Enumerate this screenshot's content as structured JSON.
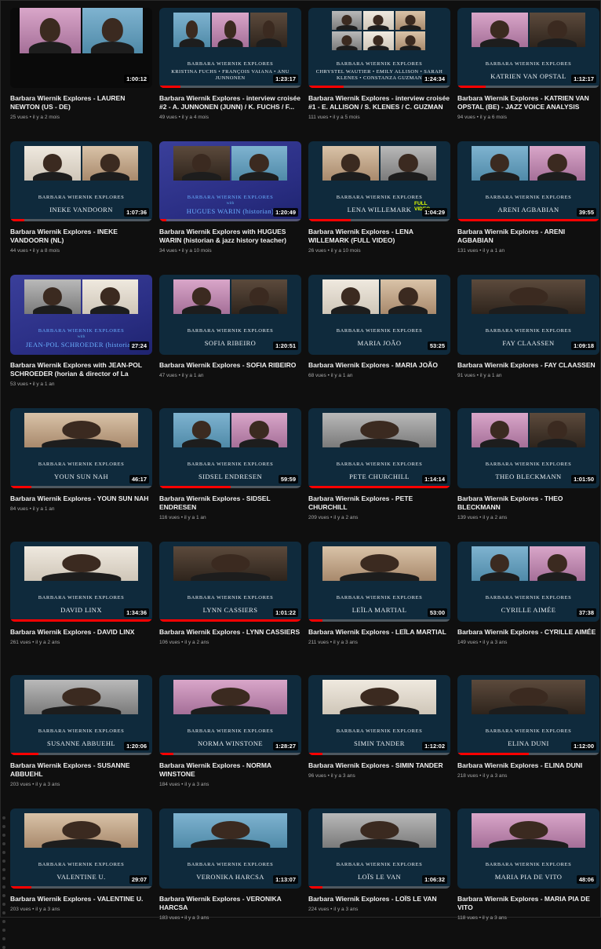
{
  "colors": {
    "background": "#0f0f0f",
    "thumbnail_navy": "#0f2a3c",
    "thumbnail_purple": "#2b2f85",
    "progress_red": "#ff0000",
    "meta_grey": "#aaaaaa"
  },
  "videos": [
    {
      "title": "Barbara Wiernik Explores - LAUREN NEWTON (US - DE)",
      "meta": "25 vues • il y a 2 mois",
      "duration": "1:00:12",
      "thumb_series": "",
      "thumb_name": "",
      "progress": 0.0,
      "style": "black",
      "photos": 2
    },
    {
      "title": "Barbara Wiernik Explores - interview croisée #2 - A. JUNNONEN (JUNN) / K. FUCHS / F...",
      "meta": "49 vues • il y a 4 mois",
      "duration": "1:23:17",
      "thumb_series": "BARBARA WIERNIK EXPLORES",
      "thumb_name": "KRISTINA FUCHS • FRANÇOIS VAIANA • ANU JUNNONEN",
      "progress": 0.15,
      "style": "navy",
      "photos": 3
    },
    {
      "title": "Barbara Wiernik Explores - interview croisée #1 - E. ALLISON / S. KLENES / C. GUZMAN ...",
      "meta": "111 vues • il y a 5 mois",
      "duration": "1:24:34",
      "thumb_series": "BARBARA WIERNIK EXPLORES",
      "thumb_name": "CHRYSTEL WAUTIER • EMILY ALLISON • SARAH KLENES • CONSTANZA GUZMAN",
      "progress": 0.25,
      "style": "navy",
      "photos": 6
    },
    {
      "title": "Barbara Wiernik Explores - KATRIEN VAN OPSTAL (BE) - JAZZ VOICE ANALYSIS",
      "meta": "94 vues • il y a 6 mois",
      "duration": "1:12:17",
      "thumb_series": "BARBARA WIERNIK EXPLORES",
      "thumb_name": "KATRIEN VAN OPSTAL",
      "progress": 0.2,
      "style": "navy",
      "photos": 2
    },
    {
      "title": "Barbara Wiernik Explores - INEKE VANDOORN (NL)",
      "meta": "44 vues • il y a 8 mois",
      "duration": "1:07:36",
      "thumb_series": "BARBARA WIERNIK EXPLORES",
      "thumb_name": "INEKE VANDOORN",
      "progress": 0.1,
      "style": "navy",
      "photos": 2
    },
    {
      "title": "Barbara Wiernik Explores with HUGUES WARIN (historian & jazz history teacher)",
      "meta": "34 vues • il y a 10 mois",
      "duration": "1:20:49",
      "thumb_series": "BARBARA WIERNIK EXPLORES",
      "thumb_name": "HUGUES WARIN (historian)",
      "thumb_with": "with",
      "progress": 0.05,
      "style": "purple",
      "photos": 2
    },
    {
      "title": "Barbara Wiernik Explores - LENA WILLEMARK (FULL VIDEO)",
      "meta": "26 vues • il y a 10 mois",
      "duration": "1:04:29",
      "thumb_series": "BARBARA WIERNIK EXPLORES",
      "thumb_name": "LENA WILLEMARK",
      "thumb_badge": "FULL VIDEO",
      "progress": 0.3,
      "style": "navy",
      "photos": 2
    },
    {
      "title": "Barbara Wiernik Explores - ARENI AGBABIAN",
      "meta": "131 vues • il y a 1 an",
      "duration": "39:55",
      "thumb_series": "BARBARA WIERNIK EXPLORES",
      "thumb_name": "ARENI AGBABIAN",
      "progress": 1.0,
      "style": "navy",
      "photos": 2
    },
    {
      "title": "Barbara Wiernik Explores with JEAN-POL SCHROEDER (horian & director of La Maiso...",
      "meta": "53 vues • il y a 1 an",
      "duration": "27:24",
      "thumb_series": "BARBARA WIERNIK EXPLORES",
      "thumb_name": "JEAN-POL SCHROEDER (historian)",
      "thumb_with": "with",
      "progress": 0.0,
      "style": "purple",
      "photos": 2
    },
    {
      "title": "Barbara Wiernik Explores - SOFIA RIBEIRO",
      "meta": "47 vues • il y a 1 an",
      "duration": "1:20:51",
      "thumb_series": "BARBARA WIERNIK EXPLORES",
      "thumb_name": "SOFIA RIBEIRO",
      "progress": 0.0,
      "style": "navy",
      "photos": 2
    },
    {
      "title": "Barbara Wiernik Explores - MARIA JOÃO",
      "meta": "68 vues • il y a 1 an",
      "duration": "53:25",
      "thumb_series": "BARBARA WIERNIK EXPLORES",
      "thumb_name": "MARIA JOÃO",
      "progress": 0.0,
      "style": "navy",
      "photos": 2
    },
    {
      "title": "Barbara Wiernik Explores - FAY CLAASSEN",
      "meta": "91 vues • il y a 1 an",
      "duration": "1:09:18",
      "thumb_series": "BARBARA WIERNIK EXPLORES",
      "thumb_name": "FAY CLAASSEN",
      "progress": 0.0,
      "style": "navy",
      "photos": 1
    },
    {
      "title": "Barbara Wiernik Explores - YOUN SUN NAH",
      "meta": "84 vues • il y a 1 an",
      "duration": "46:17",
      "thumb_series": "BARBARA WIERNIK EXPLORES",
      "thumb_name": "YOUN SUN NAH",
      "progress": 0.15,
      "style": "navy",
      "photos": 1
    },
    {
      "title": "Barbara Wiernik Explores - SIDSEL ENDRESEN",
      "meta": "116 vues • il y a 1 an",
      "duration": "59:59",
      "thumb_series": "BARBARA WIERNIK EXPLORES",
      "thumb_name": "SIDSEL ENDRESEN",
      "progress": 0.5,
      "style": "navy",
      "photos": 2
    },
    {
      "title": "Barbara Wiernik Explores - PETE CHURCHILL",
      "meta": "209 vues • il y a 2 ans",
      "duration": "1:14:14",
      "thumb_series": "BARBARA WIERNIK EXPLORES",
      "thumb_name": "PETE CHURCHILL",
      "progress": 1.0,
      "style": "navy",
      "photos": 1
    },
    {
      "title": "Barbara Wiernik Explores - THEO BLECKMANN",
      "meta": "139 vues • il y a 2 ans",
      "duration": "1:01:50",
      "thumb_series": "BARBARA WIERNIK EXPLORES",
      "thumb_name": "THEO BLECKMANN",
      "progress": 0.0,
      "style": "navy",
      "photos": 2
    },
    {
      "title": "Barbara Wiernik Explores - DAVID LINX",
      "meta": "261 vues • il y a 2 ans",
      "duration": "1:34:36",
      "thumb_series": "BARBARA WIERNIK EXPLORES",
      "thumb_name": "DAVID LINX",
      "progress": 1.0,
      "style": "navy",
      "photos": 1
    },
    {
      "title": "Barbara Wiernik Explores - LYNN CASSIERS",
      "meta": "106 vues • il y a 2 ans",
      "duration": "1:01:22",
      "thumb_series": "BARBARA WIERNIK EXPLORES",
      "thumb_name": "LYNN CASSIERS",
      "progress": 1.0,
      "style": "navy",
      "photos": 1
    },
    {
      "title": "Barbara Wiernik Explores - LEÏLA MARTIAL",
      "meta": "211 vues • il y a 3 ans",
      "duration": "53:00",
      "thumb_series": "BARBARA WIERNIK EXPLORES",
      "thumb_name": "LEÏLA MARTIAL",
      "progress": 0.1,
      "style": "navy",
      "photos": 1
    },
    {
      "title": "Barbara Wiernik Explores - CYRILLE AIMÉE",
      "meta": "149 vues • il y a 3 ans",
      "duration": "37:38",
      "thumb_series": "BARBARA WIERNIK EXPLORES",
      "thumb_name": "CYRILLE AIMÉE",
      "progress": 0.0,
      "style": "navy",
      "photos": 2
    },
    {
      "title": "Barbara Wiernik Explores - SUSANNE ABBUEHL",
      "meta": "203 vues • il y a 3 ans",
      "duration": "1:20:06",
      "thumb_series": "BARBARA WIERNIK EXPLORES",
      "thumb_name": "SUSANNE ABBUEHL",
      "progress": 0.2,
      "style": "navy",
      "photos": 1
    },
    {
      "title": "Barbara Wiernik Explores - NORMA WINSTONE",
      "meta": "184 vues • il y a 3 ans",
      "duration": "1:28:27",
      "thumb_series": "BARBARA WIERNIK EXPLORES",
      "thumb_name": "NORMA WINSTONE",
      "progress": 0.1,
      "style": "navy",
      "photos": 1
    },
    {
      "title": "Barbara Wiernik Explores - SIMIN TANDER",
      "meta": "96 vues • il y a 3 ans",
      "duration": "1:12:02",
      "thumb_series": "BARBARA WIERNIK EXPLORES",
      "thumb_name": "SIMIN TANDER",
      "progress": 0.1,
      "style": "navy",
      "photos": 1
    },
    {
      "title": "Barbara Wiernik Explores - ELINA DUNI",
      "meta": "218 vues • il y a 3 ans",
      "duration": "1:12:00",
      "thumb_series": "BARBARA WIERNIK EXPLORES",
      "thumb_name": "ELINA DUNI",
      "progress": 0.5,
      "style": "navy",
      "photos": 1
    },
    {
      "title": "Barbara Wiernik Explores - VALENTINE U.",
      "meta": "203 vues • il y a 3 ans",
      "duration": "29:07",
      "thumb_series": "BARBARA WIERNIK EXPLORES",
      "thumb_name": "VALENTINE U.",
      "progress": 0.15,
      "style": "navy",
      "photos": 1
    },
    {
      "title": "Barbara Wiernik Explores - VERONIKA HARCSA",
      "meta": "183 vues • il y a 3 ans",
      "duration": "1:13:07",
      "thumb_series": "BARBARA WIERNIK EXPLORES",
      "thumb_name": "VERONIKA HARCSA",
      "progress": 0.0,
      "style": "navy",
      "photos": 1
    },
    {
      "title": "Barbara Wiernik Explores - LOÏS LE VAN",
      "meta": "224 vues • il y a 3 ans",
      "duration": "1:06:32",
      "thumb_series": "BARBARA WIERNIK EXPLORES",
      "thumb_name": "LOÏS LE VAN",
      "progress": 0.1,
      "style": "navy",
      "photos": 1
    },
    {
      "title": "Barbara Wiernik Explores - MARIA PIA DE VITO",
      "meta": "118 vues • il y a 3 ans",
      "duration": "48:06",
      "thumb_series": "BARBARA WIERNIK EXPLORES",
      "thumb_name": "MARIA PIA DE VITO",
      "progress": 0.0,
      "style": "navy",
      "photos": 1
    }
  ]
}
